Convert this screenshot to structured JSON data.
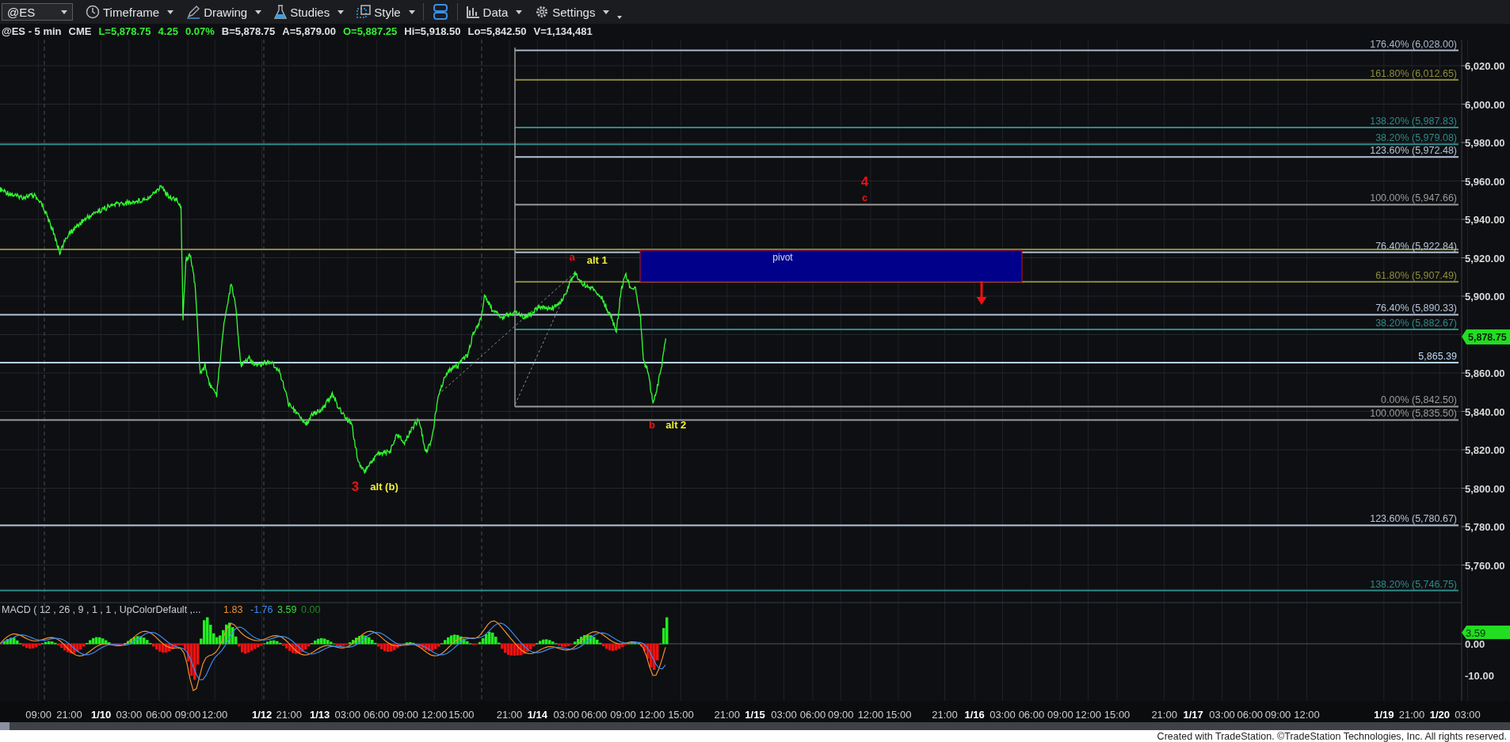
{
  "toolbar": {
    "symbol": "@ES",
    "buttons": [
      {
        "label": "Timeframe"
      },
      {
        "label": "Drawing"
      },
      {
        "label": "Studies"
      },
      {
        "label": "Style"
      },
      {
        "label": "Data"
      },
      {
        "label": "Settings"
      }
    ]
  },
  "info_bar": [
    {
      "text": "@ES - 5 min",
      "color": "#e0e0e0"
    },
    {
      "text": "CME",
      "color": "#e0e0e0"
    },
    {
      "text": "L=5,878.75",
      "color": "#33ee33"
    },
    {
      "text": "4.25",
      "color": "#33ee33"
    },
    {
      "text": "0.07%",
      "color": "#33ee33"
    },
    {
      "text": "B=5,878.75",
      "color": "#e0e0e0"
    },
    {
      "text": "A=5,879.00",
      "color": "#e0e0e0"
    },
    {
      "text": "O=5,887.25",
      "color": "#33ee33"
    },
    {
      "text": "Hi=5,918.50",
      "color": "#e0e0e0"
    },
    {
      "text": "Lo=5,842.50",
      "color": "#e0e0e0"
    },
    {
      "text": "V=1,134,481",
      "color": "#e0e0e0"
    }
  ],
  "price_axis": {
    "ticks": [
      "6,020.00",
      "6,000.00",
      "5,980.00",
      "5,960.00",
      "5,940.00",
      "5,920.00",
      "5,900.00",
      "5,860.00",
      "5,840.00",
      "5,820.00",
      "5,800.00",
      "5,780.00",
      "5,760.00"
    ],
    "last_price": "5,878.75"
  },
  "levels": [
    {
      "label": "176.40% (6,028.00)",
      "color": "#a8b8cc",
      "full_width": false
    },
    {
      "label": "161.80% (6,012.65)",
      "color": "#8c8c3c",
      "full_width": false
    },
    {
      "label": "138.20% (5,987.83)",
      "color": "#2e8a8a",
      "full_width": false
    },
    {
      "label": "38.20% (5,979.08)",
      "color": "#2e8a8a",
      "full_width": true
    },
    {
      "label": "123.60% (5,972.48)",
      "color": "#b4c4d8",
      "full_width": false
    },
    {
      "label": "100.00% (5,947.66)",
      "color": "#9a9a9a",
      "full_width": false
    },
    {
      "color": "#8c8c3c",
      "full_width": true
    },
    {
      "label": "76.40% (5,922.84)",
      "color": "#b4c4d8",
      "full_width": false
    },
    {
      "label": "61.80% (5,907.49)",
      "color": "#8c8c3c",
      "full_width": false
    },
    {
      "label": "76.40% (5,890.33)",
      "color": "#b4c4d8",
      "full_width": true
    },
    {
      "label": "38.20% (5,882.67)",
      "color": "#2e8a8a",
      "full_width": false
    },
    {
      "label": "5,865.39",
      "color": "#bcd8f4",
      "full_width": true
    },
    {
      "label": "0.00% (5,842.50)",
      "color": "#9a9a9a",
      "full_width": false
    },
    {
      "label": "100.00% (5,835.50)",
      "color": "#9a9a9a",
      "full_width": true
    },
    {
      "label": "123.60% (5,780.67)",
      "color": "#b4c4d8",
      "full_width": true
    },
    {
      "label": "138.20% (5,746.75)",
      "color": "#2e8a8a",
      "full_width": true
    }
  ],
  "wave_labels": [
    {
      "text": "4",
      "color": "#ee1111",
      "kind": "major"
    },
    {
      "text": "c",
      "color": "#ee1111",
      "kind": "minor"
    },
    {
      "text": "a",
      "color": "#ee1111",
      "kind": "minor"
    },
    {
      "text": "alt 1",
      "color": "#eeee33",
      "kind": "minor"
    },
    {
      "text": "b",
      "color": "#ee1111",
      "kind": "minor"
    },
    {
      "text": "alt 2",
      "color": "#eeee33",
      "kind": "minor"
    },
    {
      "text": "3",
      "color": "#ee1111",
      "kind": "major"
    },
    {
      "text": "alt (b)",
      "color": "#eeee33",
      "kind": "minor"
    }
  ],
  "pivot_zone": {
    "label": "pivot"
  },
  "macd": {
    "title": "MACD ( 12 , 26 , 9 , 1 , 1 , UpColorDefault ,...",
    "values": [
      {
        "text": "1.83",
        "color": "#f0902c"
      },
      {
        "text": "-1.76",
        "color": "#3c8cf0"
      },
      {
        "text": "3.59",
        "color": "#33dd33"
      },
      {
        "text": "0.00",
        "color": "#1c8c1c"
      }
    ],
    "ticks": [
      "0.00",
      "-10.00"
    ],
    "last_value": "3.59"
  },
  "time_axis": [
    {
      "text": "09:00",
      "kind": "time"
    },
    {
      "text": "21:00",
      "kind": "time"
    },
    {
      "text": "1/10",
      "kind": "date"
    },
    {
      "text": "03:00",
      "kind": "time"
    },
    {
      "text": "06:00",
      "kind": "time"
    },
    {
      "text": "09:00",
      "kind": "time"
    },
    {
      "text": "12:00",
      "kind": "time"
    },
    {
      "text": "1/12",
      "kind": "date"
    },
    {
      "text": "21:00",
      "kind": "time"
    },
    {
      "text": "1/13",
      "kind": "date"
    },
    {
      "text": "03:00",
      "kind": "time"
    },
    {
      "text": "06:00",
      "kind": "time"
    },
    {
      "text": "09:00",
      "kind": "time"
    },
    {
      "text": "12:00",
      "kind": "time"
    },
    {
      "text": "15:00",
      "kind": "time"
    },
    {
      "text": "21:00",
      "kind": "time"
    },
    {
      "text": "1/14",
      "kind": "date"
    },
    {
      "text": "03:00",
      "kind": "time"
    },
    {
      "text": "06:00",
      "kind": "time"
    },
    {
      "text": "09:00",
      "kind": "time"
    },
    {
      "text": "12:00",
      "kind": "time"
    },
    {
      "text": "15:00",
      "kind": "time"
    },
    {
      "text": "21:00",
      "kind": "time"
    },
    {
      "text": "1/15",
      "kind": "date"
    },
    {
      "text": "03:00",
      "kind": "time"
    },
    {
      "text": "06:00",
      "kind": "time"
    },
    {
      "text": "09:00",
      "kind": "time"
    },
    {
      "text": "12:00",
      "kind": "time"
    },
    {
      "text": "15:00",
      "kind": "time"
    },
    {
      "text": "21:00",
      "kind": "time"
    },
    {
      "text": "1/16",
      "kind": "date"
    },
    {
      "text": "03:00",
      "kind": "time"
    },
    {
      "text": "06:00",
      "kind": "time"
    },
    {
      "text": "09:00",
      "kind": "time"
    },
    {
      "text": "12:00",
      "kind": "time"
    },
    {
      "text": "15:00",
      "kind": "time"
    },
    {
      "text": "21:00",
      "kind": "time"
    },
    {
      "text": "1/17",
      "kind": "date"
    },
    {
      "text": "03:00",
      "kind": "time"
    },
    {
      "text": "06:00",
      "kind": "time"
    },
    {
      "text": "09:00",
      "kind": "time"
    },
    {
      "text": "12:00",
      "kind": "time"
    },
    {
      "text": "1/19",
      "kind": "date"
    },
    {
      "text": "21:00",
      "kind": "time"
    },
    {
      "text": "1/20",
      "kind": "date"
    },
    {
      "text": "03:00",
      "kind": "time"
    }
  ],
  "footer": "Created with TradeStation. ©TradeStation Technologies, Inc. All rights reserved."
}
